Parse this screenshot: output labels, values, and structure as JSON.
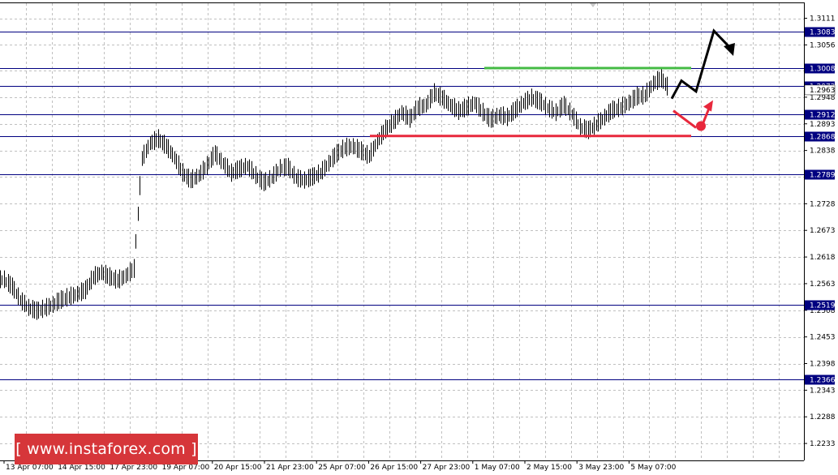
{
  "watermark": "[ www.instaforex.com ]",
  "colors": {
    "background": "#ffffff",
    "price_series": "#000000",
    "horizontal_levels": "#000080",
    "level_label_bg": "#000080",
    "resistance_line": "#44bb44",
    "support_line": "#e8283c",
    "bullish_arrow": "#000000",
    "bearish_arrow": "#e8283c",
    "grid": "#c0c0c0",
    "watermark_bg": "#d6363a"
  },
  "chart_data": {
    "type": "line",
    "title": "",
    "xlabel": "",
    "ylabel": "",
    "grid": true,
    "ylim": [
      1.2198,
      1.3142
    ],
    "x_ticks": [
      "13 Apr 07:00",
      "14 Apr 15:00",
      "17 Apr 23:00",
      "19 Apr 07:00",
      "20 Apr 15:00",
      "21 Apr 23:00",
      "25 Apr 07:00",
      "26 Apr 15:00",
      "27 Apr 23:00",
      "1 May 07:00",
      "2 May 15:00",
      "3 May 23:00",
      "5 May 07:00"
    ],
    "y_ticks": [
      1.3111,
      1.3056,
      1.3003,
      1.2948,
      1.2893,
      1.2838,
      1.2783,
      1.2728,
      1.2673,
      1.2618,
      1.2563,
      1.2508,
      1.2453,
      1.2398,
      1.2343,
      1.2288,
      1.2233
    ],
    "horizontal_levels": [
      1.3083,
      1.3008,
      1.2972,
      1.2912,
      1.2868,
      1.2789,
      1.2519,
      1.2366
    ],
    "current_price": 1.2963,
    "series": [
      {
        "values": [
          1.257,
          1.2555,
          1.2528,
          1.2512,
          1.2505,
          1.251,
          1.2518,
          1.2528,
          1.2534,
          1.254,
          1.2548,
          1.2575,
          1.2585,
          1.2575,
          1.2568,
          1.2578,
          1.2592,
          1.282,
          1.2852,
          1.286,
          1.2845,
          1.2822,
          1.279,
          1.2775,
          1.2785,
          1.2805,
          1.283,
          1.281,
          1.279,
          1.2798,
          1.2805,
          1.2785,
          1.277,
          1.278,
          1.28,
          1.2802,
          1.278,
          1.2775,
          1.2782,
          1.279,
          1.281,
          1.283,
          1.2842,
          1.2845,
          1.2835,
          1.2825,
          1.2855,
          1.288,
          1.2895,
          1.2915,
          1.2902,
          1.2925,
          1.293,
          1.2955,
          1.2945,
          1.293,
          1.2918,
          1.2925,
          1.2935,
          1.2915,
          1.29,
          1.291,
          1.2905,
          1.292,
          1.2935,
          1.2945,
          1.2938,
          1.2925,
          1.2915,
          1.293,
          1.2912,
          1.2885,
          1.2878,
          1.289,
          1.2905,
          1.292,
          1.2925,
          1.2935,
          1.2948,
          1.295,
          1.2975,
          1.2985,
          1.2963
        ]
      }
    ],
    "annotations": {
      "resistance_level": 1.3008,
      "support_level": 1.2868,
      "bullish_path": [
        1.2945,
        1.2982,
        1.296,
        1.3085,
        1.305
      ],
      "bearish_path": [
        1.292,
        1.2885,
        1.2935
      ]
    }
  }
}
